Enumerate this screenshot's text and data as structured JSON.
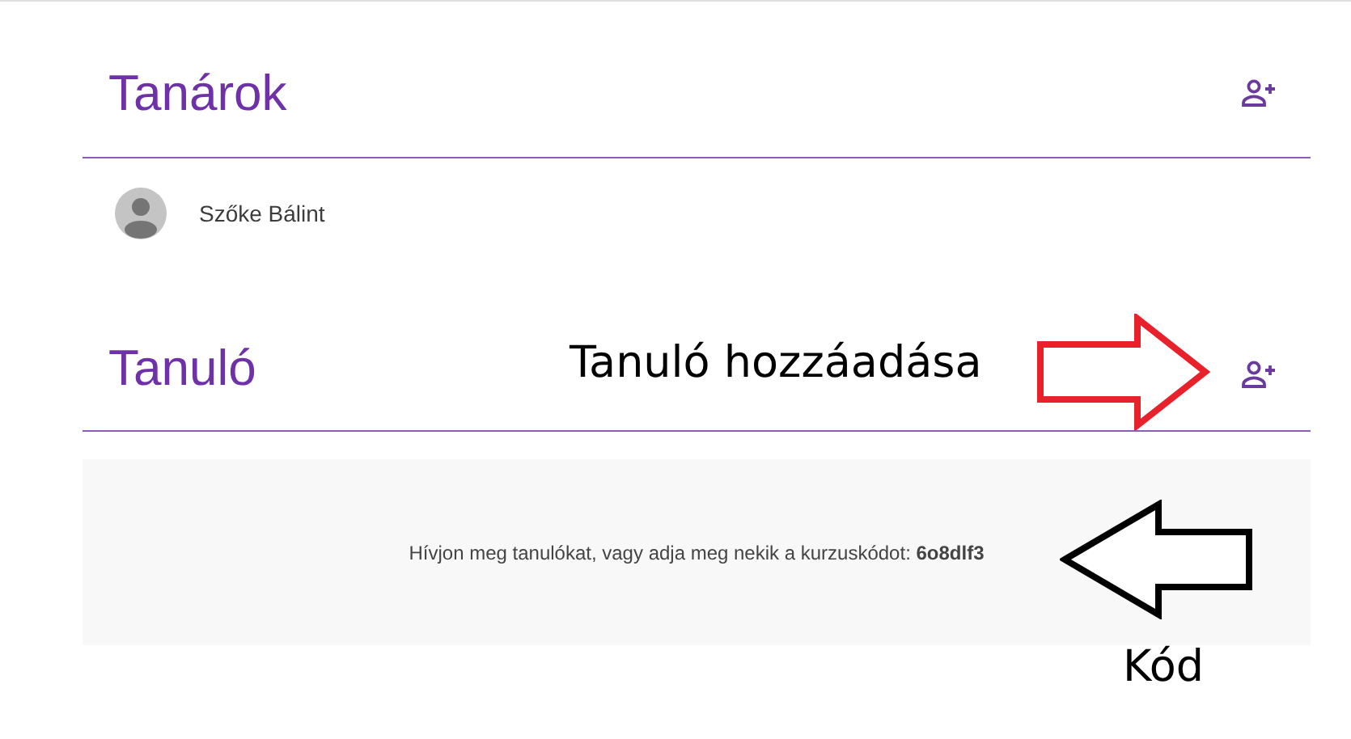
{
  "sections": [
    {
      "title": "Tanárok",
      "members": [
        {
          "name": "Szőke Bálint"
        }
      ]
    },
    {
      "title": "Tanuló",
      "empty_message": "Hívjon meg tanulókat, vagy adja meg nekik a kurzuskódot: **6o8dlf3**"
    }
  ],
  "annotations": [
    {
      "text": "Tanuló hozzáadása",
      "kind": "right",
      "color": "#e8212a"
    },
    {
      "text": "Kód",
      "kind": "left",
      "color": "#000000"
    }
  ]
}
